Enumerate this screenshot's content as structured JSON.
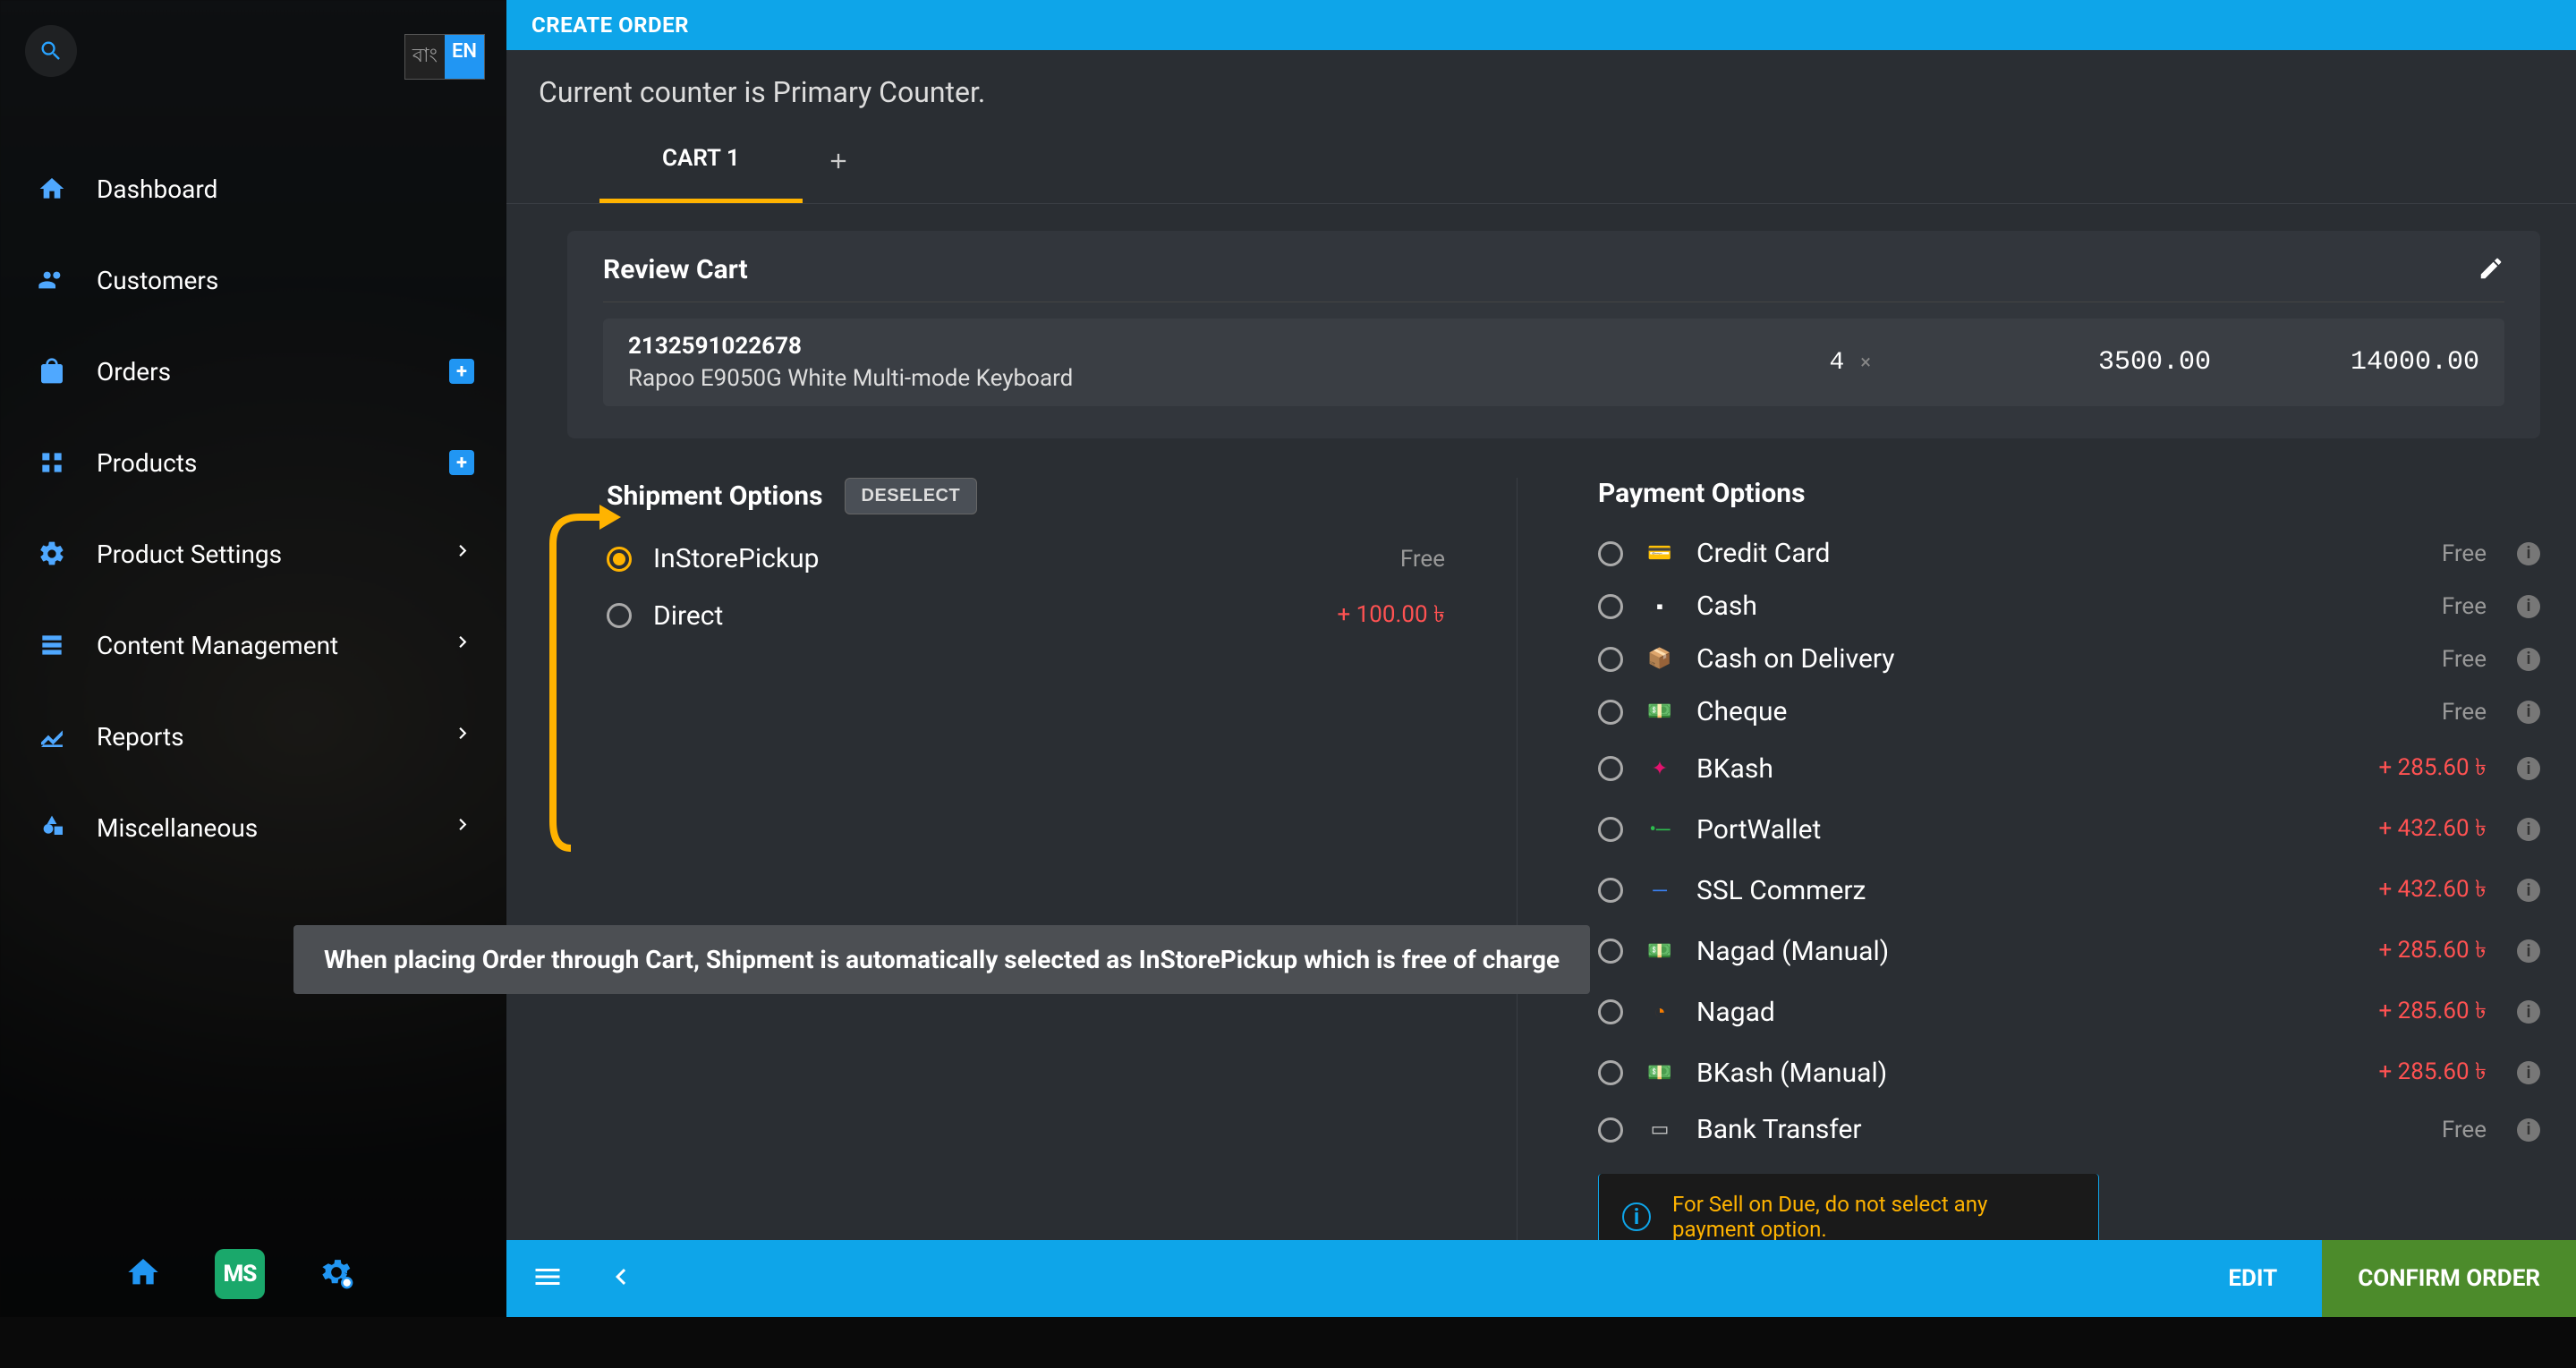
{
  "lang": {
    "ban": "বাং",
    "en": "EN"
  },
  "sidebar": {
    "items": [
      {
        "label": "Dashboard"
      },
      {
        "label": "Customers"
      },
      {
        "label": "Orders"
      },
      {
        "label": "Products"
      },
      {
        "label": "Product Settings"
      },
      {
        "label": "Content Management"
      },
      {
        "label": "Reports"
      },
      {
        "label": "Miscellaneous"
      }
    ],
    "ms_badge": "MS"
  },
  "header": {
    "title": "CREATE ORDER"
  },
  "counter": "Current counter is Primary Counter.",
  "cart": {
    "tab_label": "CART 1",
    "review_title": "Review Cart",
    "item": {
      "sku": "2132591022678",
      "name": "Rapoo E9050G White Multi-mode Keyboard",
      "qty": "4",
      "x": "×",
      "price": "3500.00",
      "total": "14000.00"
    }
  },
  "shipment": {
    "title": "Shipment Options",
    "deselect": "DESELECT",
    "options": [
      {
        "label": "InStorePickup",
        "cost": "Free",
        "selected": true,
        "charge": false
      },
      {
        "label": "Direct",
        "cost": "+ 100.00 ৳",
        "selected": false,
        "charge": true
      }
    ]
  },
  "payment": {
    "title": "Payment Options",
    "options": [
      {
        "label": "Credit Card",
        "cost": "Free",
        "charge": false,
        "icon": "💳",
        "color": "#2dbd4e"
      },
      {
        "label": "Cash",
        "cost": "Free",
        "charge": false,
        "icon": "▪",
        "color": "#fff"
      },
      {
        "label": "Cash on Delivery",
        "cost": "Free",
        "charge": false,
        "icon": "📦",
        "color": "#ccc"
      },
      {
        "label": "Cheque",
        "cost": "Free",
        "charge": false,
        "icon": "💵",
        "color": "#2dbd4e"
      },
      {
        "label": "BKash",
        "cost": "+ 285.60 ৳",
        "charge": true,
        "icon": "✦",
        "color": "#e2136e"
      },
      {
        "label": "PortWallet",
        "cost": "+ 432.60 ৳",
        "charge": true,
        "icon": "•─",
        "color": "#2dbd4e"
      },
      {
        "label": "SSL Commerz",
        "cost": "+ 432.60 ৳",
        "charge": true,
        "icon": "─",
        "color": "#3b82f6"
      },
      {
        "label": "Nagad (Manual)",
        "cost": "+ 285.60 ৳",
        "charge": true,
        "icon": "💵",
        "color": "#2dbd4e"
      },
      {
        "label": "Nagad",
        "cost": "+ 285.60 ৳",
        "charge": true,
        "icon": "◔",
        "color": "#f57c00"
      },
      {
        "label": "BKash (Manual)",
        "cost": "+ 285.60 ৳",
        "charge": true,
        "icon": "💵",
        "color": "#2dbd4e"
      },
      {
        "label": "Bank Transfer",
        "cost": "Free",
        "charge": false,
        "icon": "▭",
        "color": "#ccc"
      }
    ],
    "due_note": "For Sell on Due, do not select any payment option."
  },
  "callout": "When placing Order through Cart, Shipment is automatically selected as InStorePickup which is free of charge",
  "footer": {
    "edit": "EDIT",
    "confirm": "CONFIRM ORDER"
  }
}
